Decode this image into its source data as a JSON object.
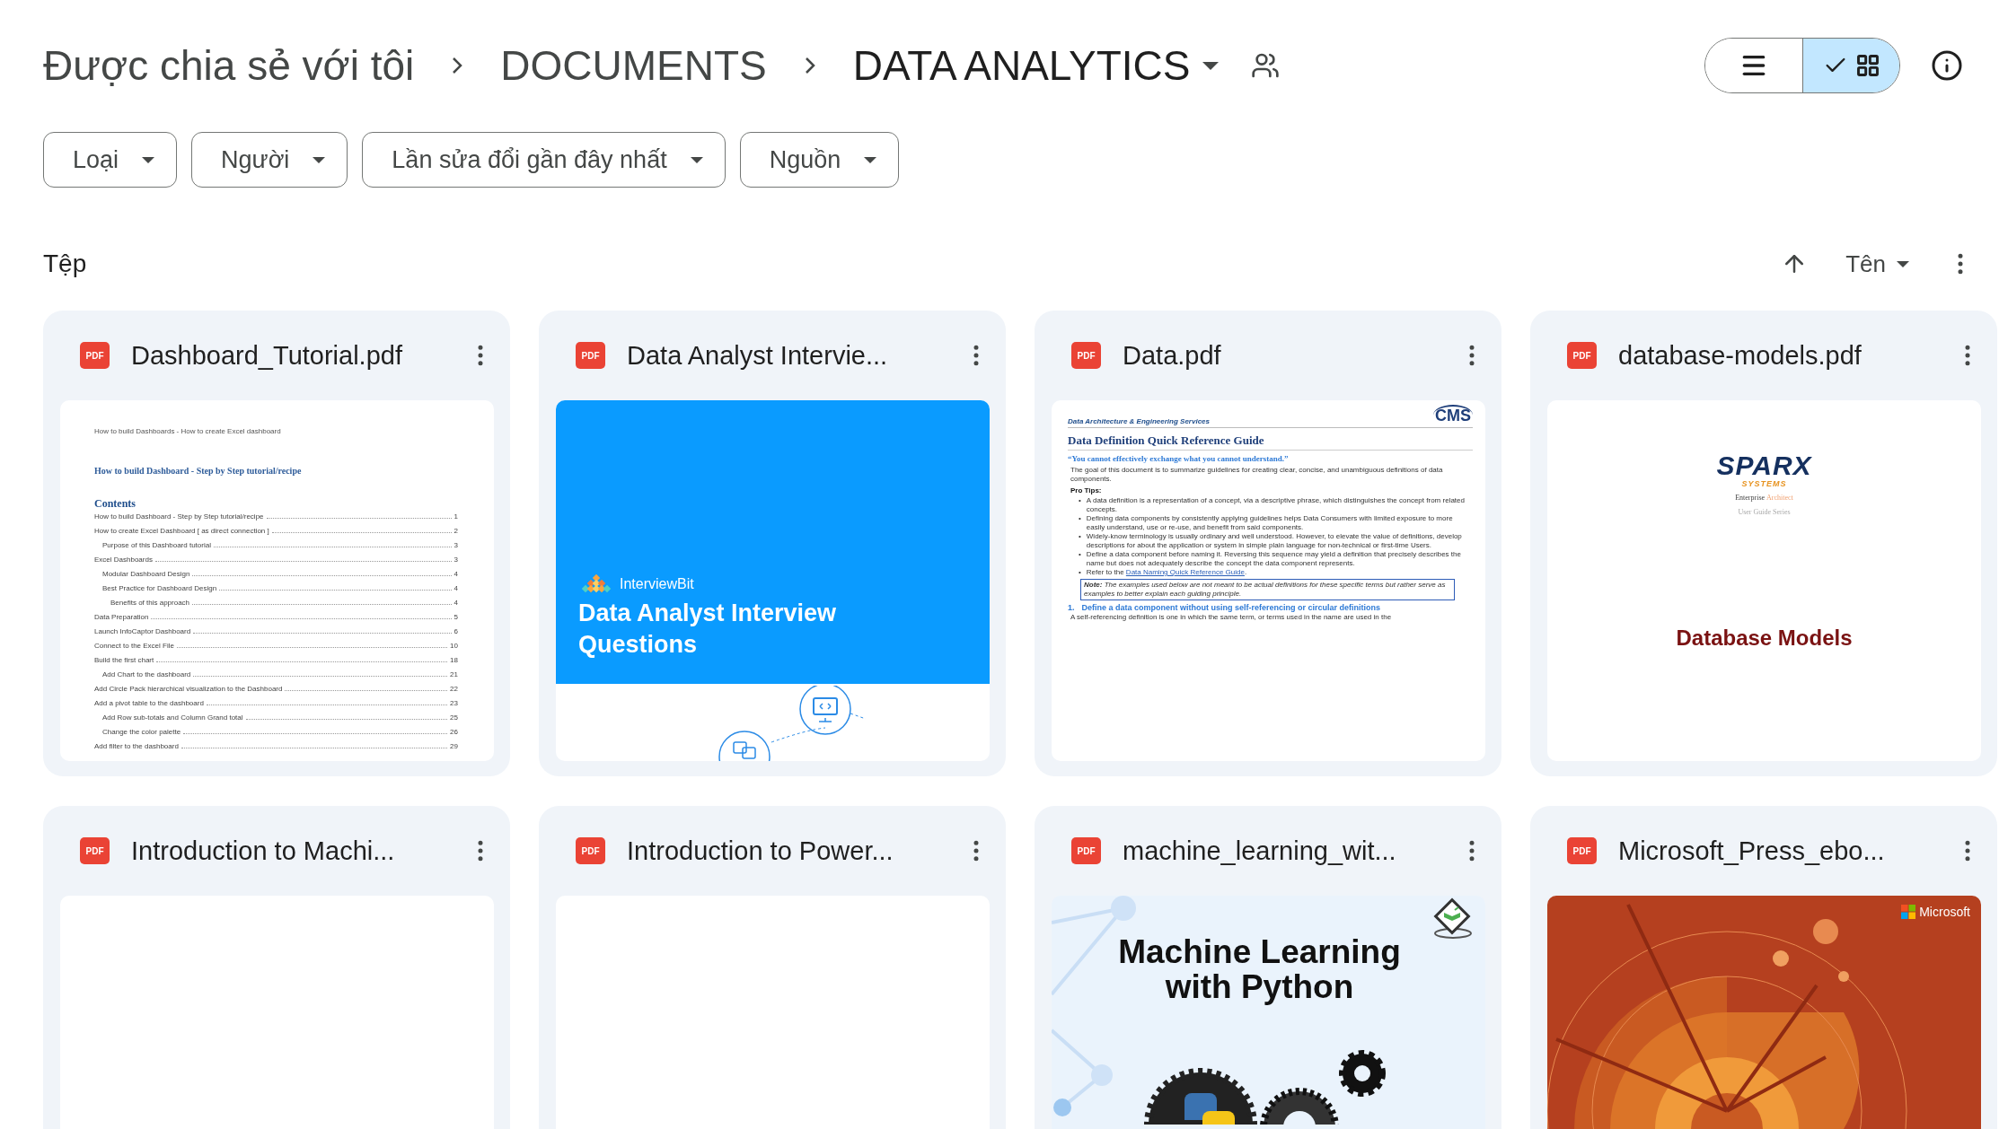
{
  "breadcrumb": [
    {
      "label": "Được chia sẻ với tôi",
      "current": false
    },
    {
      "label": "DOCUMENTS",
      "current": false
    },
    {
      "label": "DATA ANALYTICS",
      "current": true
    }
  ],
  "view_toggle": [
    {
      "kind": "list",
      "selected": false
    },
    {
      "kind": "grid",
      "selected": true
    }
  ],
  "filters": [
    "Loại",
    "Người",
    "Lần sửa đổi gần đây nhất",
    "Nguồn"
  ],
  "section_title": "Tệp",
  "sort": {
    "label": "Tên"
  },
  "files": [
    {
      "name": "Dashboard_Tutorial.pdf",
      "badge": "PDF",
      "preview": {
        "kind": "toc",
        "header": "How to build Dashboards - How to create Excel dashboard",
        "title": "How to build Dashboard - Step by Step tutorial/recipe",
        "heading": "Contents",
        "entries": [
          {
            "text": "How to build Dashboard - Step by Step tutorial/recipe",
            "page": "1"
          },
          {
            "text": "How to create Excel Dashboard [ as direct connection ]",
            "page": "2",
            "children": [
              {
                "text": "Purpose of this Dashboard tutorial",
                "page": "3"
              }
            ]
          },
          {
            "text": "Excel Dashboards",
            "page": "3",
            "children": [
              {
                "text": "Modular Dashboard Design",
                "page": "4"
              },
              {
                "text": "Best Practice for Dashboard Design",
                "page": "4",
                "children": [
                  {
                    "text": "Benefits of this approach",
                    "page": "4"
                  }
                ]
              }
            ]
          },
          {
            "text": "Data Preparation",
            "page": "5"
          },
          {
            "text": "Launch InfoCaptor Dashboard",
            "page": "6"
          },
          {
            "text": "Connect to the Excel File",
            "page": "10"
          },
          {
            "text": "Build the first chart",
            "page": "18",
            "children": [
              {
                "text": "Add Chart to the dashboard",
                "page": "21"
              }
            ]
          },
          {
            "text": "Add Circle Pack hierarchical visualization to the Dashboard",
            "page": "22"
          },
          {
            "text": "Add a pivot table to the dashboard",
            "page": "23",
            "children": [
              {
                "text": "Add Row sub-totals and Column Grand total",
                "page": "25"
              },
              {
                "text": "Change the color palette",
                "page": "26"
              }
            ]
          },
          {
            "text": "Add filter to the dashboard",
            "page": "29"
          }
        ]
      }
    },
    {
      "name": "Data Analyst Intervie...",
      "badge": "PDF",
      "preview": {
        "kind": "cover_banner",
        "brand": "InterviewBit",
        "title": "Data Analyst Interview Questions"
      }
    },
    {
      "name": "Data.pdf",
      "badge": "PDF",
      "preview": {
        "kind": "reference_guide",
        "header": "Data Architecture & Engineering Services",
        "logo": "CMS",
        "title": "Data Definition Quick Reference Guide",
        "quote": "“You cannot effectively exchange what you cannot understand.”",
        "intro": "The goal of this document is to summarize guidelines for creating clear, concise, and unambiguous definitions of data components.",
        "tips_label": "Pro Tips:",
        "tips": [
          {
            "marker": "•",
            "text": "A data definition is a representation of a concept, via a descriptive phrase, which distinguishes the concept from related concepts."
          },
          {
            "marker": "•",
            "text": "Defining data components by consistently applying guidelines helps Data Consumers with limited exposure to more easily understand, use or re-use, and benefit from said components."
          },
          {
            "marker": "•",
            "text": "Widely-know terminology is usually ordinary and well understood. However, to elevate the value of definitions, develop descriptions for about the application or system in simple plain language for non-technical or first-time Users."
          },
          {
            "marker": "•",
            "text": "Define a data component before naming it. Reversing this sequence may yield a definition that precisely describes the name but does not adequately describe the concept the data component represents."
          },
          {
            "marker": "•",
            "text": "Refer to the",
            "link": "Data Naming Quick Reference Guide",
            "after": "."
          }
        ],
        "note": "**Note:** The examples used below are not meant to be actual definitions for these specific terms but rather serve as examples to better explain each guiding principle.",
        "section_number": "1.",
        "section_title": "Define a data component without using self-referencing or circular definitions",
        "body": "A self-referencing definition is one in which the same term, or terms used in the name are used in the"
      }
    },
    {
      "name": "database-models.pdf",
      "badge": "PDF",
      "preview": {
        "kind": "title_page",
        "brand": "SPARX",
        "brand_sub": "SYSTEMS",
        "product_a": "Enterprise",
        "product_b": "Architect",
        "series": "User Guide Series",
        "title": "Database Models"
      }
    },
    {
      "name": "Introduction to Machi...",
      "badge": "PDF",
      "preview": {
        "kind": "blank"
      }
    },
    {
      "name": "Introduction to Power...",
      "badge": "PDF",
      "preview": {
        "kind": "blank"
      }
    },
    {
      "name": "machine_learning_wit...",
      "badge": "PDF",
      "preview": {
        "kind": "ml_cover",
        "title_lines": [
          "Machine Learning",
          "with Python"
        ]
      }
    },
    {
      "name": "Microsoft_Press_ebo...",
      "badge": "PDF",
      "preview": {
        "kind": "brand_cover",
        "brand": "Microsoft"
      }
    }
  ]
}
